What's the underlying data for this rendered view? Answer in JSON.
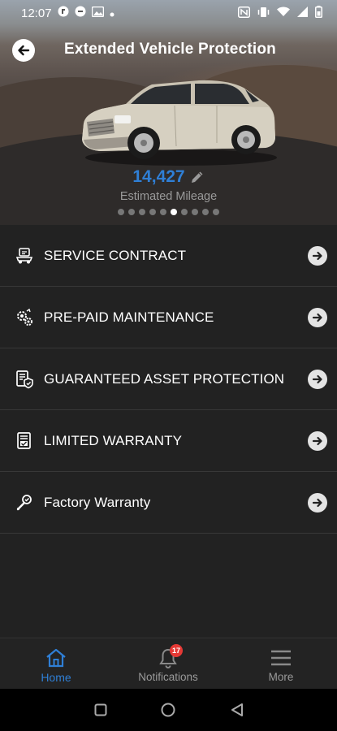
{
  "status_bar": {
    "time": "12:07",
    "left_icons": [
      "app-notification-icon",
      "app-notification-icon",
      "image-icon",
      "dot-icon"
    ],
    "right_icons": [
      "nfc-icon",
      "vibrate-icon",
      "wifi-icon",
      "signal-icon",
      "battery-icon"
    ]
  },
  "header": {
    "title": "Extended Vehicle Protection",
    "back_icon": "back-arrow-icon"
  },
  "vehicle": {
    "image": "silver-suv",
    "mileage": "14,427",
    "mileage_label": "Estimated Mileage",
    "edit_icon": "pencil-icon",
    "carousel": {
      "count": 10,
      "active_index": 5
    }
  },
  "menu": {
    "items": [
      {
        "label": "SERVICE CONTRACT",
        "icon": "car-contract-icon"
      },
      {
        "label": "PRE-PAID MAINTENANCE",
        "icon": "gears-icon"
      },
      {
        "label": "GUARANTEED ASSET PROTECTION",
        "icon": "document-shield-icon"
      },
      {
        "label": "LIMITED WARRANTY",
        "icon": "document-check-icon"
      },
      {
        "label": "Factory Warranty",
        "icon": "wrench-check-icon"
      }
    ]
  },
  "bottom_nav": {
    "home": {
      "label": "Home",
      "icon": "house-icon"
    },
    "notifications": {
      "label": "Notifications",
      "icon": "bell-icon",
      "badge": "17"
    },
    "more": {
      "label": "More",
      "icon": "hamburger-icon"
    }
  },
  "colors": {
    "accent": "#2f7fd6",
    "background": "#222222",
    "badge": "#e53935"
  }
}
